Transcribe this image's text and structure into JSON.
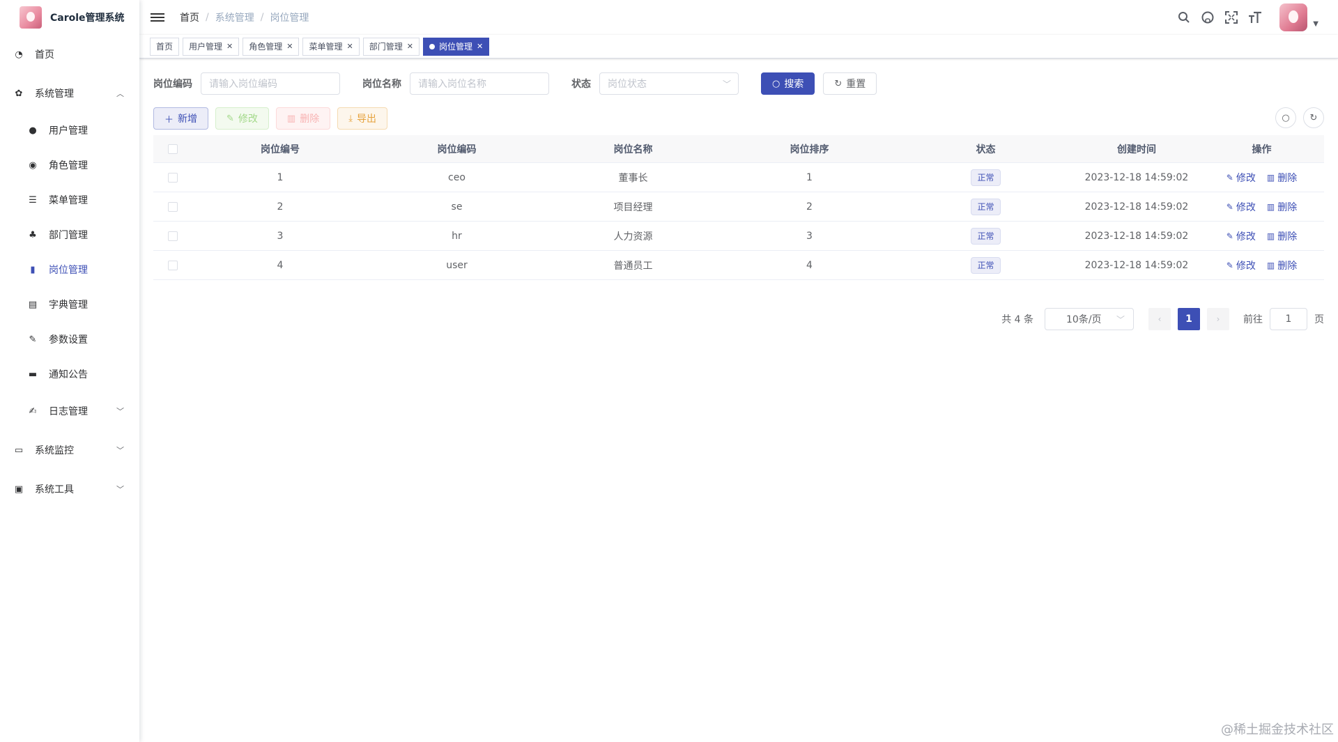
{
  "app": {
    "title": "Carole管理系统"
  },
  "sidebar": {
    "items": [
      {
        "label": "首页",
        "icon": "dashboard-icon"
      },
      {
        "label": "系统管理",
        "icon": "gear-icon"
      },
      {
        "label": "用户管理",
        "icon": "user-icon"
      },
      {
        "label": "角色管理",
        "icon": "users-icon"
      },
      {
        "label": "菜单管理",
        "icon": "tree-table-icon"
      },
      {
        "label": "部门管理",
        "icon": "org-tree-icon"
      },
      {
        "label": "岗位管理",
        "icon": "post-icon"
      },
      {
        "label": "字典管理",
        "icon": "dict-icon"
      },
      {
        "label": "参数设置",
        "icon": "edit-icon"
      },
      {
        "label": "通知公告",
        "icon": "message-icon"
      },
      {
        "label": "日志管理",
        "icon": "log-icon"
      },
      {
        "label": "系统监控",
        "icon": "monitor-icon"
      },
      {
        "label": "系统工具",
        "icon": "tool-icon"
      }
    ]
  },
  "breadcrumb": [
    "首页",
    "系统管理",
    "岗位管理"
  ],
  "tags": [
    "首页",
    "用户管理",
    "角色管理",
    "菜单管理",
    "部门管理",
    "岗位管理"
  ],
  "search": {
    "code_label": "岗位编码",
    "code_placeholder": "请输入岗位编码",
    "name_label": "岗位名称",
    "name_placeholder": "请输入岗位名称",
    "status_label": "状态",
    "status_placeholder": "岗位状态",
    "search_btn": "搜索",
    "reset_btn": "重置"
  },
  "toolbar": {
    "add": "新增",
    "edit": "修改",
    "delete": "删除",
    "export": "导出"
  },
  "table": {
    "headers": [
      "岗位编号",
      "岗位编码",
      "岗位名称",
      "岗位排序",
      "状态",
      "创建时间",
      "操作"
    ],
    "rows": [
      {
        "id": "1",
        "code": "ceo",
        "name": "董事长",
        "sort": "1",
        "status": "正常",
        "time": "2023-12-18 14:59:02"
      },
      {
        "id": "2",
        "code": "se",
        "name": "项目经理",
        "sort": "2",
        "status": "正常",
        "time": "2023-12-18 14:59:02"
      },
      {
        "id": "3",
        "code": "hr",
        "name": "人力资源",
        "sort": "3",
        "status": "正常",
        "time": "2023-12-18 14:59:02"
      },
      {
        "id": "4",
        "code": "user",
        "name": "普通员工",
        "sort": "4",
        "status": "正常",
        "time": "2023-12-18 14:59:02"
      }
    ],
    "op_edit": "修改",
    "op_delete": "删除"
  },
  "pagination": {
    "total": "共 4 条",
    "page_size": "10条/页",
    "current": "1",
    "goto": "前往",
    "goto_value": "1",
    "page_unit": "页"
  },
  "watermark": "@稀土掘金技术社区",
  "colors": {
    "primary": "#3d4fb5",
    "warning": "#e6a23c"
  }
}
